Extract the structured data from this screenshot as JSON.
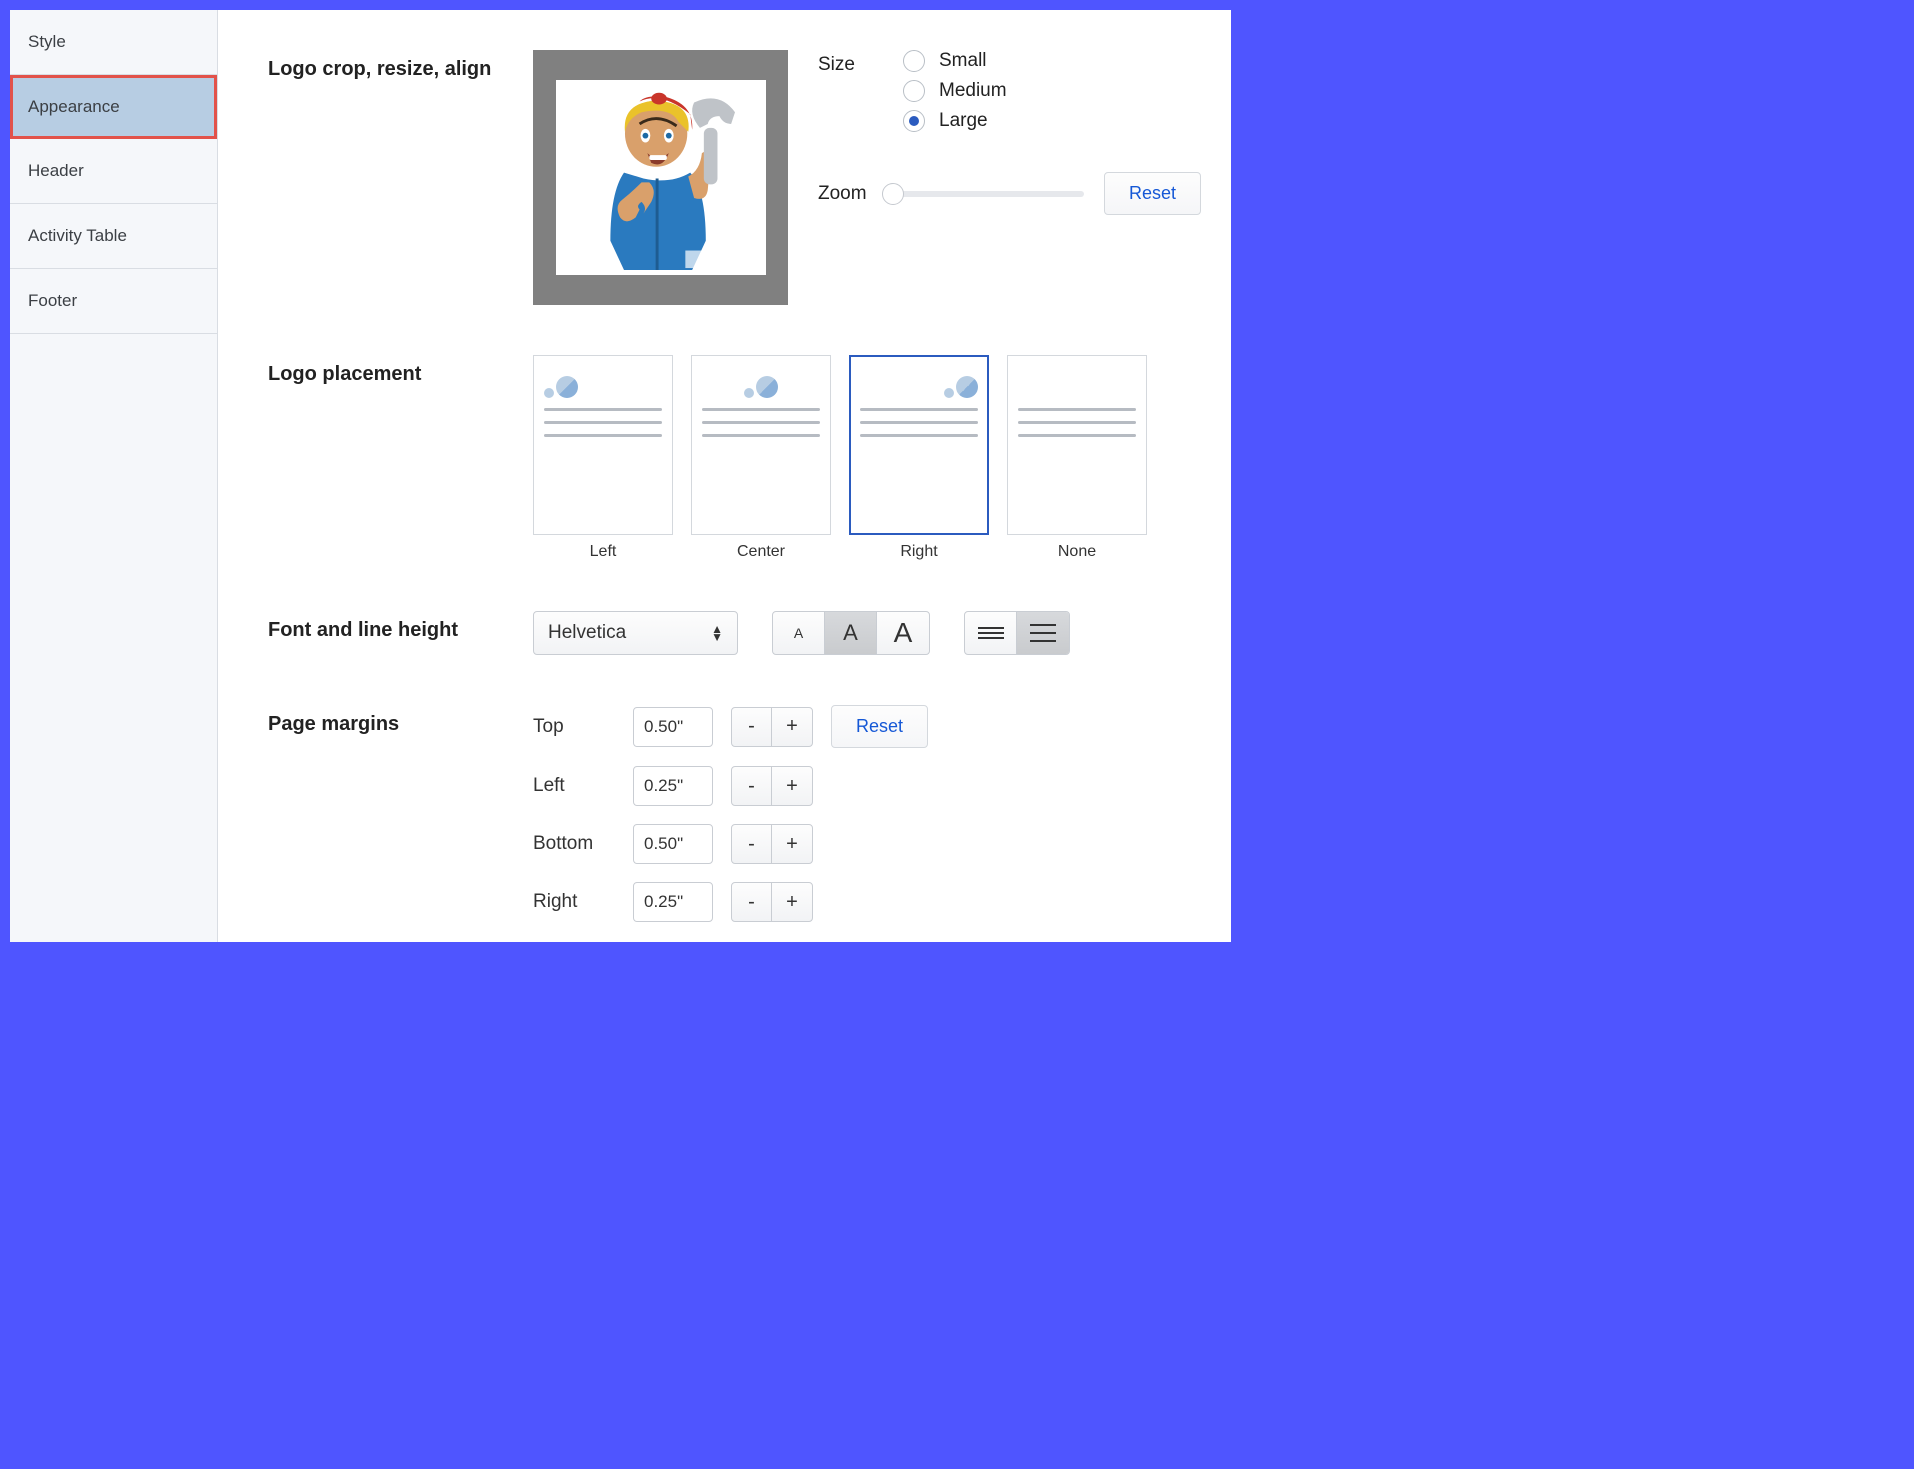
{
  "sidebar": {
    "items": [
      {
        "label": "Style"
      },
      {
        "label": "Appearance"
      },
      {
        "label": "Header"
      },
      {
        "label": "Activity Table"
      },
      {
        "label": "Footer"
      }
    ],
    "active_index": 1
  },
  "sections": {
    "logo_crop": {
      "title": "Logo crop, resize, align",
      "size_label": "Size",
      "size_options": [
        "Small",
        "Medium",
        "Large"
      ],
      "size_selected": "Large",
      "zoom_label": "Zoom",
      "zoom_value": 0,
      "reset_label": "Reset"
    },
    "logo_placement": {
      "title": "Logo placement",
      "options": [
        "Left",
        "Center",
        "Right",
        "None"
      ],
      "selected": "Right"
    },
    "font": {
      "title": "Font and line height",
      "family": "Helvetica",
      "font_size_selected": "medium",
      "line_height_selected": "loose"
    },
    "margins": {
      "title": "Page margins",
      "reset_label": "Reset",
      "rows": [
        {
          "label": "Top",
          "value": "0.50\""
        },
        {
          "label": "Left",
          "value": "0.25\""
        },
        {
          "label": "Bottom",
          "value": "0.50\""
        },
        {
          "label": "Right",
          "value": "0.25\""
        }
      ],
      "minus": "-",
      "plus": "+"
    }
  }
}
